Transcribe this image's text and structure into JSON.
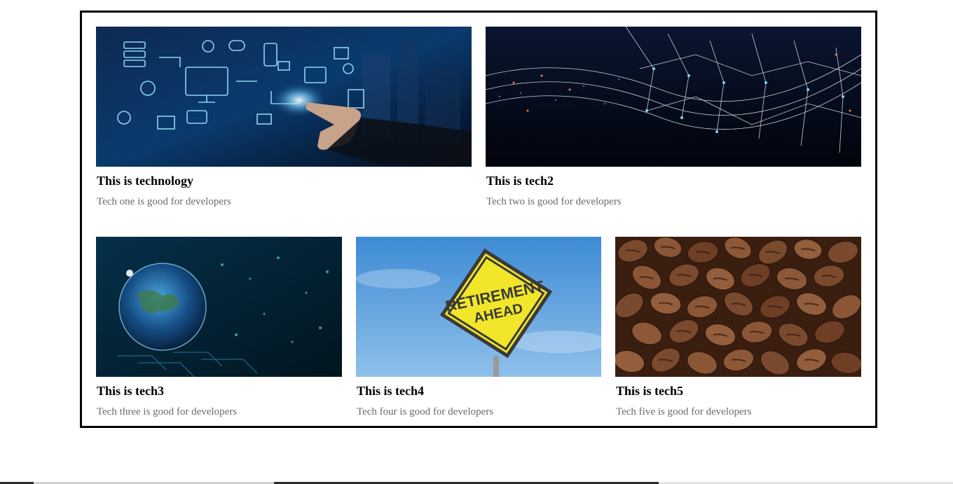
{
  "cards": [
    {
      "title": "This is technology",
      "description": "Tech one is good for developers",
      "image": "technology-network-image"
    },
    {
      "title": "This is tech2",
      "description": "Tech two is good for developers",
      "image": "digital-wave-mesh-image"
    },
    {
      "title": "This is tech3",
      "description": "Tech three is good for developers",
      "image": "digital-globe-image"
    },
    {
      "title": "This is tech4",
      "description": "Tech four is good for developers",
      "image": "retirement-ahead-sign-image",
      "sign_line1": "RETIREMENT",
      "sign_line2": "AHEAD"
    },
    {
      "title": "This is tech5",
      "description": "Tech five is good for developers",
      "image": "coffee-beans-image"
    }
  ],
  "colors": {
    "border": "#000000",
    "title": "#000000",
    "description": "#6b6b6b"
  }
}
